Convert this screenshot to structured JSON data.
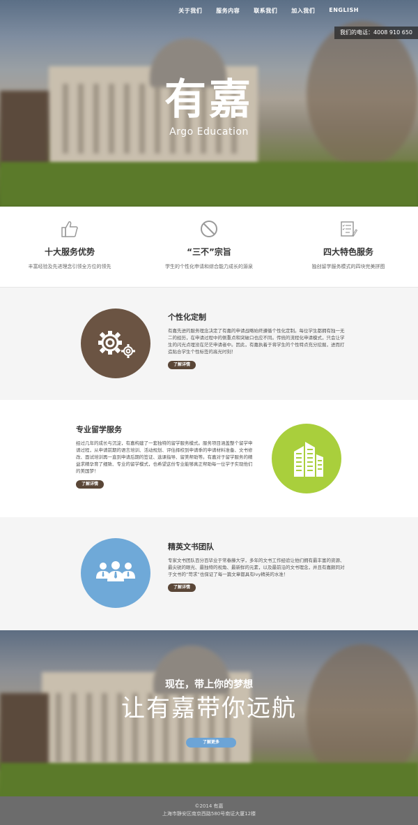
{
  "nav": {
    "items": [
      "关于我们",
      "服务内容",
      "联系我们",
      "加入我们",
      "ENGLISH"
    ]
  },
  "hero": {
    "phone": "我们的电话：4008 910 650",
    "logo_cn": "有嘉",
    "logo_en": "Argo Education"
  },
  "features": [
    {
      "icon": "thumbs-up-icon",
      "title": "十大服务优势",
      "desc": "丰富经验及先进理念引领全方位的领先"
    },
    {
      "icon": "prohibited-icon",
      "title": "“三不”宗旨",
      "desc": "学生的个性化申请和综合能力成长的源泉"
    },
    {
      "icon": "checklist-icon",
      "title": "四大特色服务",
      "desc": "独创留学服务模式的四块完美拼图"
    }
  ],
  "sections": [
    {
      "title": "个性化定制",
      "body": "有嘉先进的服务理念决定了有嘉的申请战略始终遵循个性化定制。每位学生都拥有独一无二的经历，在申请过程中的侧重点和突破口也应不同。传统的流程化申请模式，只会让学生的闪光点埋没在茫茫申请者中。因此，有嘉执着于将学生的个性特点充分挖掘，进而打造贴合学生个性标签的高光时刻！",
      "button": "了解详情",
      "icon": "gears-icon",
      "color": "#6b5443"
    },
    {
      "title": "专业留学服务",
      "body": "经过几年的成长与沉淀，有嘉构建了一套独特的留学服务模式。服务项目涵盖整个留学申请过程，从申请前期的语言培训、活动规划、评估择校到申请季的申请材料准备、文书修改、面试培训再一直到申请后期的签证、选课指导、留美帮助等。有嘉对于留学服务的精益求精孕育了细致、专业的留学模式，也希望这份专业能够真正帮助每一位学子实现他们的美国梦！",
      "button": "了解详情",
      "icon": "buildings-icon",
      "color": "#a9cf3c"
    },
    {
      "title": "精英文书团队",
      "body": "专家文书团队百分百毕业于常春藤大学，多年的文书工作经验让他们拥有最丰富的资源、最尖锐的眼光、最独特的视角、最新鲜的元素，以及最前沿的文书理念，并且有嘉颇同对于文书的“苛求”也保证了每一篇文章都具有Ivy精英的水准！",
      "button": "了解详情",
      "icon": "team-icon",
      "color": "#6fa9d8"
    }
  ],
  "cta": {
    "subtitle": "现在，带上你的梦想",
    "title": "让有嘉带你远航",
    "button": "了解更多"
  },
  "footer": {
    "copyright": "©2014 有嘉",
    "address": "上海市静安区南京西路580号南证大厦12楼"
  }
}
